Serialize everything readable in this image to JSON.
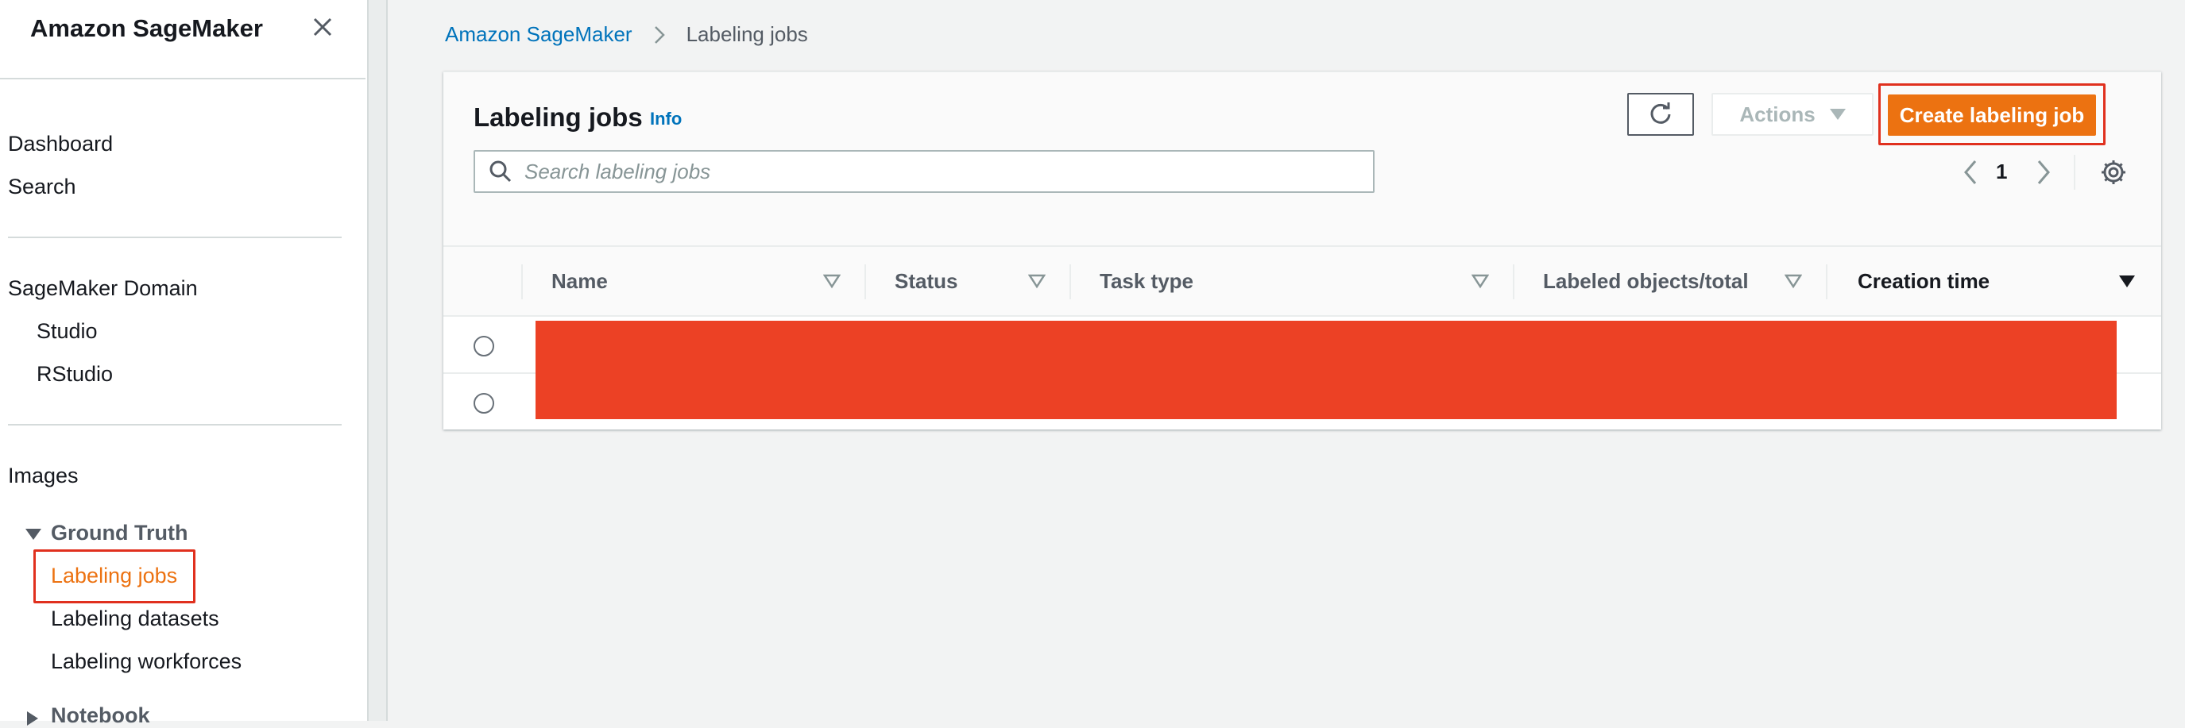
{
  "sidebar": {
    "brand": "Amazon SageMaker",
    "items_top": [
      "Dashboard",
      "Search"
    ],
    "domain_group": "SageMaker Domain",
    "domain_items": [
      "Studio",
      "RStudio"
    ],
    "images": "Images",
    "ground_truth": "Ground Truth",
    "ground_truth_items": [
      "Labeling jobs",
      "Labeling datasets",
      "Labeling workforces"
    ],
    "notebook": "Notebook"
  },
  "breadcrumb": {
    "root": "Amazon SageMaker",
    "current": "Labeling jobs"
  },
  "panel": {
    "title": "Labeling jobs",
    "info": "Info",
    "actions_label": "Actions",
    "create_label": "Create labeling job",
    "search_placeholder": "Search labeling jobs",
    "page_number": "1"
  },
  "table": {
    "columns": [
      "Name",
      "Status",
      "Task type",
      "Labeled objects/total",
      "Creation time"
    ],
    "sorted_column": "Creation time",
    "row_count": 2
  },
  "colors": {
    "accent": "#ec7211",
    "link": "#0073bb",
    "redaction": "#ec4125",
    "highlight_outline": "#e0301e"
  },
  "icons": [
    "close-icon",
    "chevron-right-icon",
    "refresh-icon",
    "caret-down-icon",
    "search-icon",
    "chevron-left-icon",
    "gear-icon",
    "sort-icon"
  ]
}
